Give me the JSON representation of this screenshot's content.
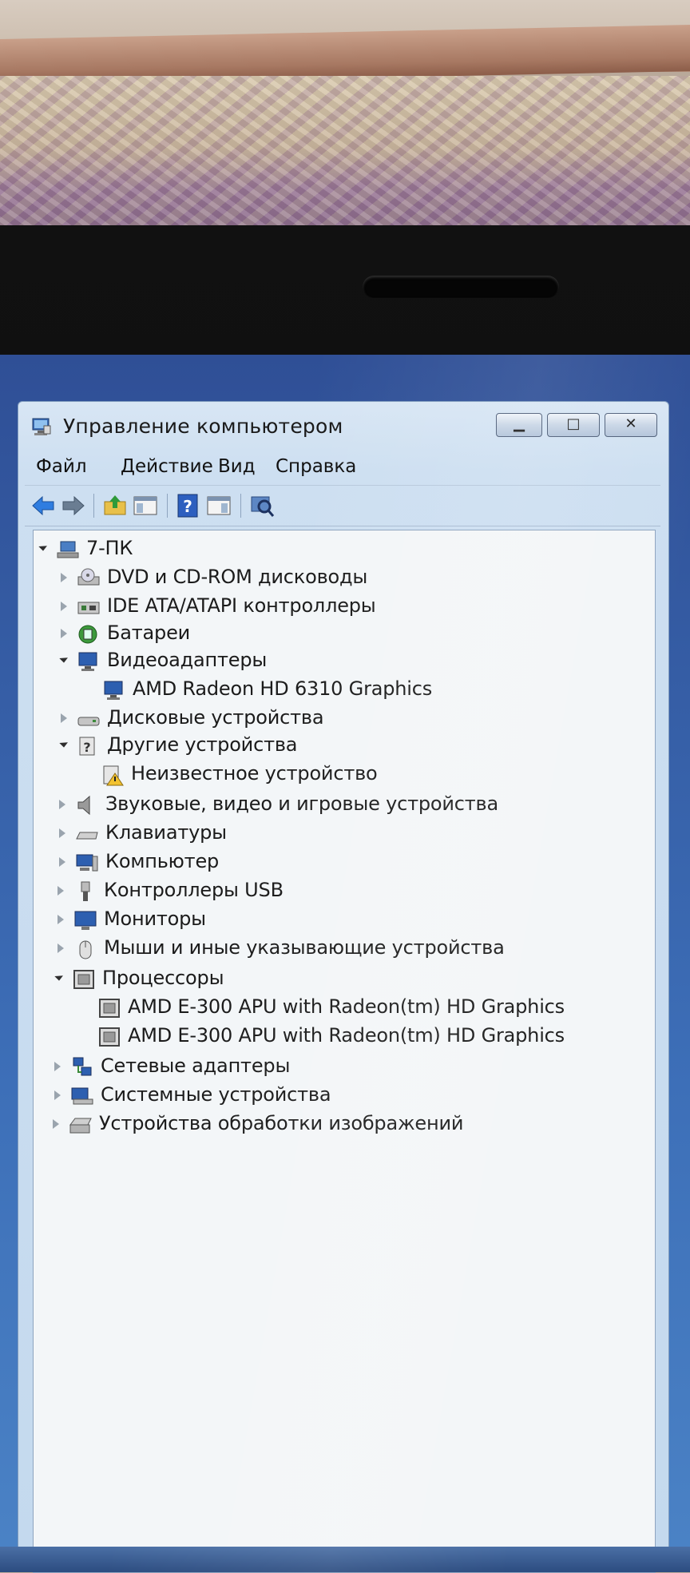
{
  "window": {
    "title": "Управление компьютером",
    "min_symbol": "▁",
    "max_symbol": "□",
    "close_symbol": "✕"
  },
  "menu": {
    "items": [
      "Файл",
      "Действие",
      "Вид",
      "Справка"
    ]
  },
  "toolbar": {
    "icons": [
      "back-arrow-icon",
      "forward-arrow-icon",
      "up-folder-icon",
      "show-hide-tree-icon",
      "help-icon",
      "action-pane-icon",
      "scan-hardware-icon"
    ]
  },
  "tree": {
    "root": {
      "label": "7-ПК",
      "icon": "computer-network-icon",
      "expanded": true
    },
    "nodes": [
      {
        "label": "DVD и CD-ROM дисководы",
        "icon": "dvd-drive-icon",
        "level": 1,
        "state": "collapsed"
      },
      {
        "label": "IDE ATA/ATAPI контроллеры",
        "icon": "ide-controller-icon",
        "level": 1,
        "state": "collapsed"
      },
      {
        "label": "Батареи",
        "icon": "battery-icon",
        "level": 1,
        "state": "collapsed"
      },
      {
        "label": "Видеоадаптеры",
        "icon": "display-adapter-icon",
        "level": 1,
        "state": "expanded"
      },
      {
        "label": "AMD Radeon HD 6310 Graphics",
        "icon": "display-adapter-icon",
        "level": 2,
        "state": "leaf"
      },
      {
        "label": "Дисковые устройства",
        "icon": "disk-drive-icon",
        "level": 1,
        "state": "collapsed"
      },
      {
        "label": "Другие устройства",
        "icon": "unknown-device-icon",
        "level": 1,
        "state": "expanded"
      },
      {
        "label": "Неизвестное устройство",
        "icon": "warning-device-icon",
        "level": 2,
        "state": "leaf"
      },
      {
        "label": "Звуковые, видео и игровые устройства",
        "icon": "speaker-icon",
        "level": 1,
        "state": "collapsed"
      },
      {
        "label": "Клавиатуры",
        "icon": "keyboard-icon",
        "level": 1,
        "state": "collapsed"
      },
      {
        "label": "Компьютер",
        "icon": "computer-icon",
        "level": 1,
        "state": "collapsed"
      },
      {
        "label": "Контроллеры USB",
        "icon": "usb-icon",
        "level": 1,
        "state": "collapsed"
      },
      {
        "label": "Мониторы",
        "icon": "monitor-icon",
        "level": 1,
        "state": "collapsed"
      },
      {
        "label": "Мыши и иные указывающие устройства",
        "icon": "mouse-icon",
        "level": 1,
        "state": "collapsed"
      },
      {
        "label": "Процессоры",
        "icon": "processor-icon",
        "level": 1,
        "state": "expanded"
      },
      {
        "label": "AMD E-300 APU with Radeon(tm) HD Graphics",
        "icon": "processor-icon",
        "level": 2,
        "state": "leaf"
      },
      {
        "label": "AMD E-300 APU with Radeon(tm) HD Graphics",
        "icon": "processor-icon",
        "level": 2,
        "state": "leaf"
      },
      {
        "label": "Сетевые адаптеры",
        "icon": "network-adapter-icon",
        "level": 1,
        "state": "collapsed"
      },
      {
        "label": "Системные устройства",
        "icon": "system-device-icon",
        "level": 1,
        "state": "collapsed"
      },
      {
        "label": "Устройства обработки изображений",
        "icon": "imaging-device-icon",
        "level": 1,
        "state": "collapsed"
      }
    ]
  },
  "colors": {
    "accent": "#3a6fb8",
    "tree_bg": "#f3f6f8",
    "text": "#1b1b1b"
  }
}
